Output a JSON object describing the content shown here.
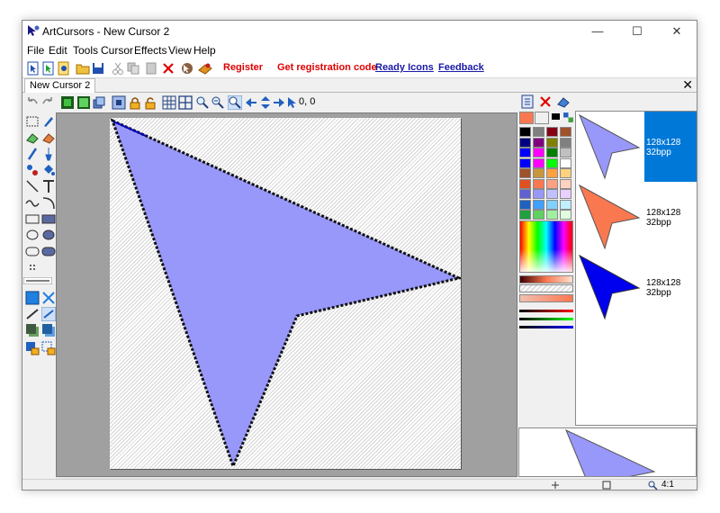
{
  "window": {
    "title": "ArtCursors - New Cursor 2",
    "minimize": "—",
    "maximize": "☐",
    "close": "✕"
  },
  "menu": [
    "File",
    "Edit",
    "Tools",
    "Cursor",
    "Effects",
    "View",
    "Help"
  ],
  "toolbar_links": {
    "register": "Register",
    "get_code": "Get registration code",
    "ready_icons": "Ready Icons",
    "feedback": "Feedback"
  },
  "document_tab": {
    "label": "New Cursor 2",
    "close": "✕"
  },
  "coords_readout": "0, 0",
  "cursor_list": [
    {
      "size": "128x128",
      "depth": "32bpp",
      "color": "#9898fa",
      "selected": true
    },
    {
      "size": "128x128",
      "depth": "32bpp",
      "color": "#fa7850",
      "selected": false
    },
    {
      "size": "128x128",
      "depth": "32bpp",
      "color": "#0000ee",
      "selected": false
    }
  ],
  "status": {
    "zoom": "4:1"
  },
  "colors": {
    "accent_selected": "#0078d7",
    "cursor_fill": "#9898fa",
    "foreground_swatch": "#fa7850"
  },
  "palette": [
    "#000000",
    "#7f7f7f",
    "#880015",
    "#a0522d",
    "#000080",
    "#800080",
    "#808000",
    "#808080",
    "#0000ff",
    "#ff00ff",
    "#008000",
    "#c0c0c0",
    "#0000ff",
    "#ff00ff",
    "#00ff00",
    "#ffffff",
    "#a0522d",
    "#c8963c",
    "#ffa040",
    "#ffd27f",
    "#e05020",
    "#fa7850",
    "#ffa080",
    "#ffd2c0",
    "#6060d0",
    "#9898fa",
    "#c0c0ff",
    "#e8d0ff",
    "#2060c0",
    "#40a0ff",
    "#80d0ff",
    "#c0f0ff",
    "#20a040",
    "#60d060",
    "#a0f0a0",
    "#e0ffe0"
  ]
}
